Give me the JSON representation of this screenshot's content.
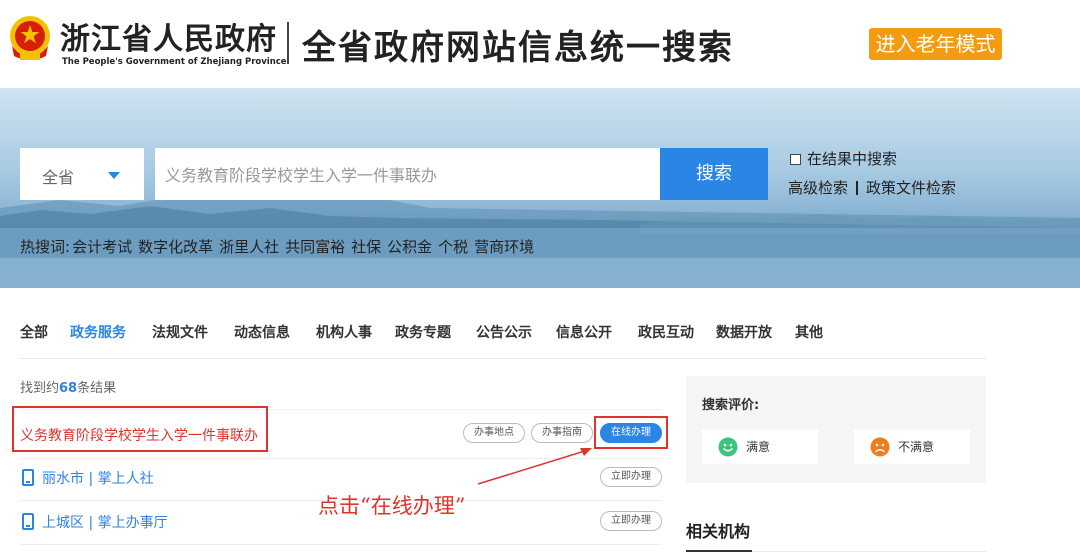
{
  "header": {
    "site_cn": "浙江省人民政府",
    "site_en": "The People's Government of Zhejiang Province",
    "search_title": "全省政府网站信息统一搜索",
    "elder_mode": "进入老年模式"
  },
  "search": {
    "region": "全省",
    "query": "义务教育阶段学校学生入学一件事联办",
    "button": "搜索",
    "in_result": "在结果中搜索",
    "advanced": "高级检索",
    "policy": "政策文件检索"
  },
  "hot": {
    "label": "热搜词:",
    "words": [
      "会计考试",
      "数字化改革",
      "浙里人社",
      "共同富裕",
      "社保",
      "公积金",
      "个税",
      "营商环境"
    ]
  },
  "tabs": [
    "全部",
    "政务服务",
    "法规文件",
    "动态信息",
    "机构人事",
    "政务专题",
    "公告公示",
    "信息公开",
    "政民互动",
    "数据开放",
    "其他"
  ],
  "results": {
    "count_prefix": "找到约",
    "count": "68",
    "count_suffix": "条结果",
    "main_title": "义务教育阶段学校学生入学一件事联办",
    "btn_location": "办事地点",
    "btn_guide": "办事指南",
    "btn_online": "在线办理",
    "sub_items": [
      {
        "name": "丽水市 | 掌上人社",
        "action": "立即办理"
      },
      {
        "name": "上城区 | 掌上办事厅",
        "action": "立即办理"
      }
    ]
  },
  "annotation": "点击“在线办理”",
  "eval": {
    "title": "搜索评价:",
    "satisfied": "满意",
    "unsatisfied": "不满意"
  },
  "related": "相关机构",
  "colors": {
    "primary": "#2b85e4",
    "accent_orange": "#f39c12",
    "annotation_red": "#e0332e"
  }
}
